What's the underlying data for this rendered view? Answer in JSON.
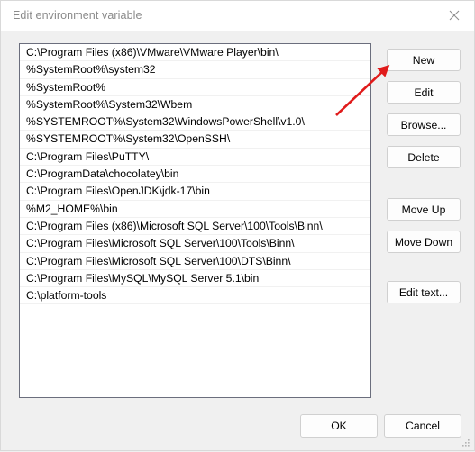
{
  "window": {
    "title": "Edit environment variable",
    "close_icon": "close-icon"
  },
  "list": {
    "rows": [
      "C:\\Program Files (x86)\\VMware\\VMware Player\\bin\\",
      "%SystemRoot%\\system32",
      "%SystemRoot%",
      "%SystemRoot%\\System32\\Wbem",
      "%SYSTEMROOT%\\System32\\WindowsPowerShell\\v1.0\\",
      "%SYSTEMROOT%\\System32\\OpenSSH\\",
      "C:\\Program Files\\PuTTY\\",
      "C:\\ProgramData\\chocolatey\\bin",
      "C:\\Program Files\\OpenJDK\\jdk-17\\bin",
      "%M2_HOME%\\bin",
      "C:\\Program Files (x86)\\Microsoft SQL Server\\100\\Tools\\Binn\\",
      "C:\\Program Files\\Microsoft SQL Server\\100\\Tools\\Binn\\",
      "C:\\Program Files\\Microsoft SQL Server\\100\\DTS\\Binn\\",
      "C:\\Program Files\\MySQL\\MySQL Server 5.1\\bin",
      "C:\\platform-tools"
    ]
  },
  "side_buttons": {
    "new": "New",
    "edit": "Edit",
    "browse": "Browse...",
    "delete": "Delete",
    "move_up": "Move Up",
    "move_down": "Move Down",
    "edit_text": "Edit text..."
  },
  "footer_buttons": {
    "ok": "OK",
    "cancel": "Cancel"
  },
  "annotation": {
    "arrow_color": "#e01b1b",
    "points_to": "New"
  }
}
